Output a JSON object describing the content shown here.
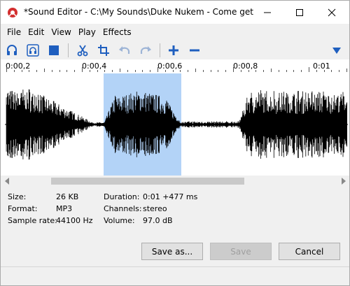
{
  "window": {
    "title": "*Sound Editor - C:\\My Sounds\\Duke Nukem - Come get so...",
    "controls": [
      "minimize",
      "maximize",
      "close"
    ]
  },
  "menu": [
    "File",
    "Edit",
    "View",
    "Play",
    "Effects"
  ],
  "toolbar": {
    "icons": [
      "headphones-icon",
      "headphones-selection-icon",
      "stop-icon",
      "cut-icon",
      "crop-icon",
      "undo-icon",
      "redo-icon",
      "zoom-in-icon",
      "zoom-out-icon",
      "dropdown-arrow-icon"
    ],
    "accent": "#1f5fbf"
  },
  "ruler": {
    "labels": [
      "0:00,2",
      "0:00,4",
      "0:00,6",
      "0:00,8",
      "0:01"
    ]
  },
  "waveform": {
    "selection_start_s": 0.4,
    "selection_end_s": 0.6,
    "selection_color": "#b3d3f7"
  },
  "info": {
    "size_label": "Size:",
    "size_value": "26 KB",
    "format_label": "Format:",
    "format_value": "MP3",
    "sample_rate_label": "Sample rate:",
    "sample_rate_value": "44100 Hz",
    "duration_label": "Duration:",
    "duration_value": "0:01 +477 ms",
    "channels_label": "Channels:",
    "channels_value": "stereo",
    "volume_label": "Volume:",
    "volume_value": "97.0 dB"
  },
  "buttons": {
    "save_as": "Save as...",
    "save": "Save",
    "cancel": "Cancel"
  }
}
